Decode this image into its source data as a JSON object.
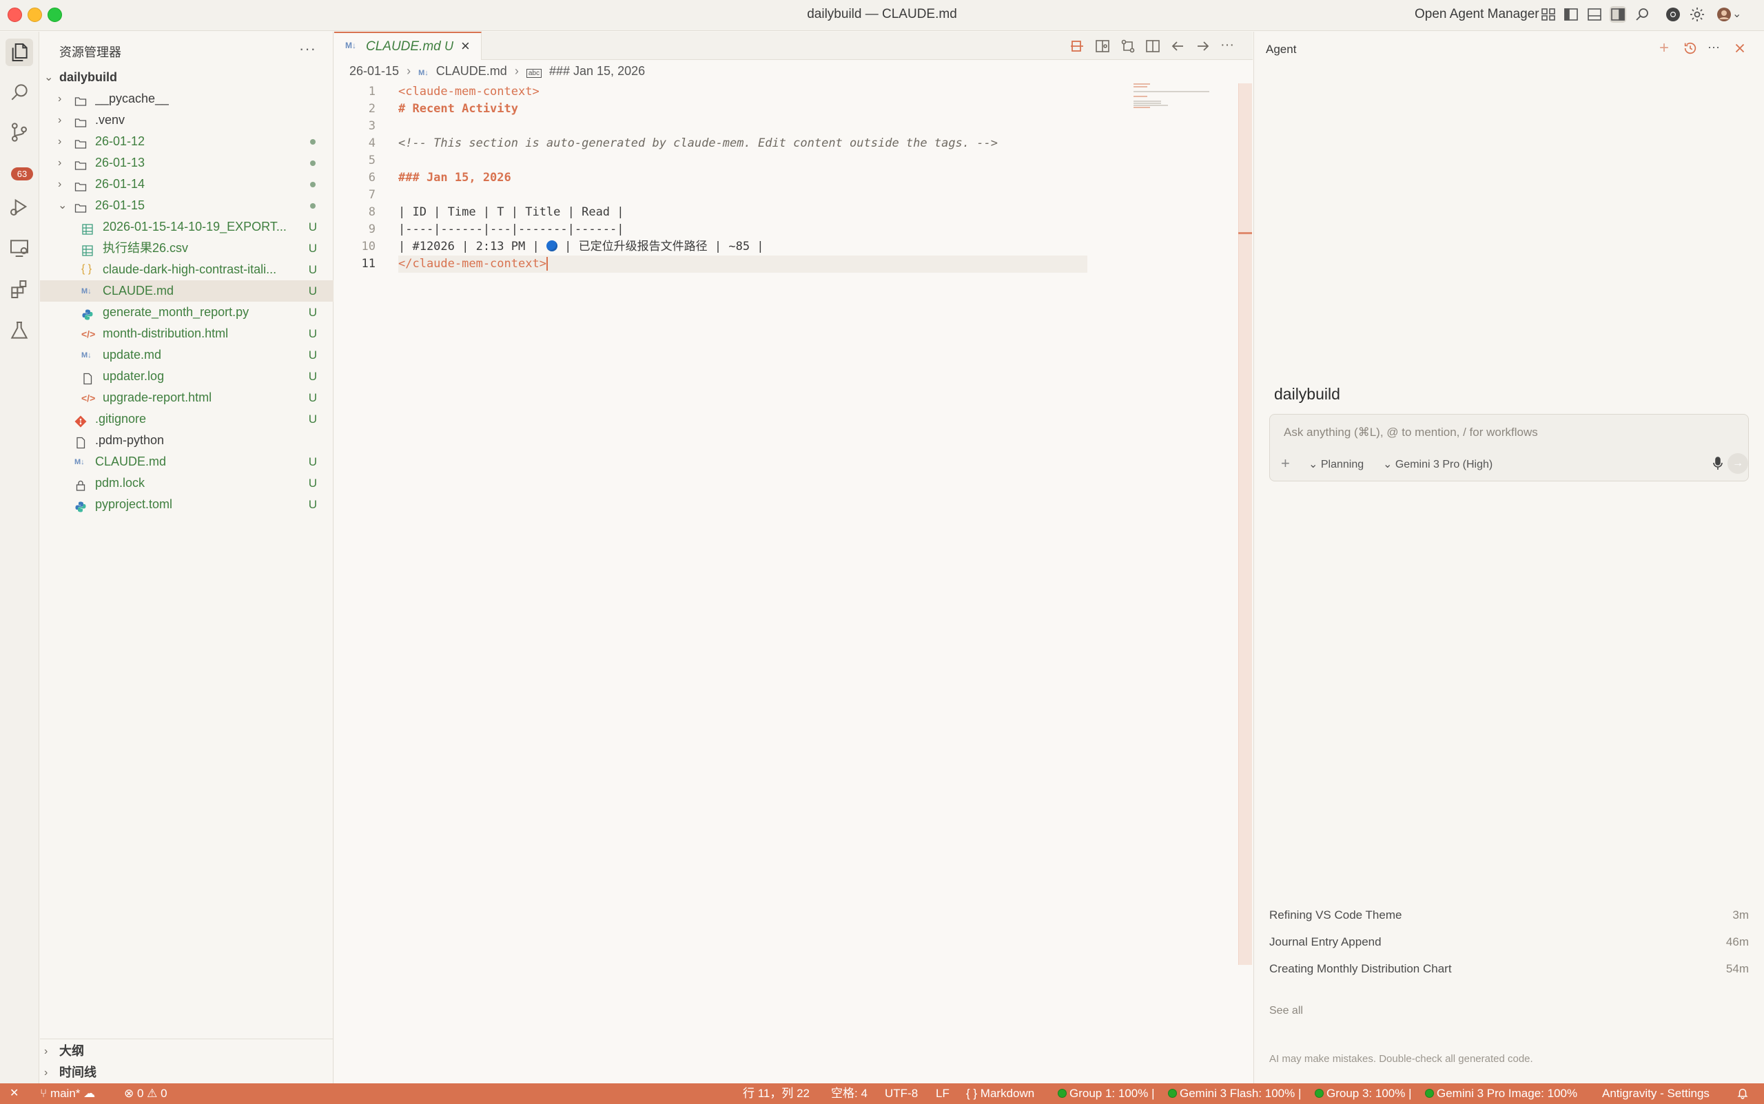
{
  "window": {
    "title": "dailybuild — CLAUDE.md",
    "open_agent_manager": "Open Agent Manager"
  },
  "activity_bar": {
    "scm_badge": "63"
  },
  "sidebar": {
    "title": "资源管理器",
    "more": "···",
    "root": "dailybuild",
    "items": [
      {
        "name": "__pycache__",
        "status": ""
      },
      {
        "name": ".venv",
        "status": ""
      },
      {
        "name": "26-01-12",
        "status": ""
      },
      {
        "name": "26-01-13",
        "status": ""
      },
      {
        "name": "26-01-14",
        "status": ""
      },
      {
        "name": "26-01-15",
        "status": ""
      },
      {
        "name": "2026-01-15-14-10-19_EXPORT...",
        "status": "U"
      },
      {
        "name": "执行结果26.csv",
        "status": "U"
      },
      {
        "name": "claude-dark-high-contrast-itali...",
        "status": "U"
      },
      {
        "name": "CLAUDE.md",
        "status": "U"
      },
      {
        "name": "generate_month_report.py",
        "status": "U"
      },
      {
        "name": "month-distribution.html",
        "status": "U"
      },
      {
        "name": "update.md",
        "status": "U"
      },
      {
        "name": "updater.log",
        "status": "U"
      },
      {
        "name": "upgrade-report.html",
        "status": "U"
      },
      {
        "name": ".gitignore",
        "status": "U"
      },
      {
        "name": ".pdm-python",
        "status": ""
      },
      {
        "name": "CLAUDE.md",
        "status": "U"
      },
      {
        "name": "pdm.lock",
        "status": "U"
      },
      {
        "name": "pyproject.toml",
        "status": "U"
      }
    ],
    "outline": "大纲",
    "timeline": "时间线"
  },
  "editor": {
    "tab": {
      "label": "CLAUDE.md",
      "status": "U",
      "icon": "M↓"
    },
    "breadcrumb": [
      "26-01-15",
      "CLAUDE.md",
      "### Jan 15, 2026"
    ],
    "lines": [
      "<claude-mem-context>",
      "# Recent Activity",
      "",
      "<!-- This section is auto-generated by claude-mem. Edit content outside the tags. -->",
      "",
      "### Jan 15, 2026",
      "",
      "| ID | Time | T | Title | Read |",
      "|----|------|---|-------|------|",
      "| #12026 | 2:13 PM | ",
      " | 已定位升级报告文件路径 | ~85 |",
      "</claude-mem-context>"
    ],
    "line_numbers": [
      "1",
      "2",
      "3",
      "4",
      "5",
      "6",
      "7",
      "8",
      "9",
      "10",
      "11"
    ]
  },
  "agent": {
    "title": "Agent",
    "workspace": "dailybuild",
    "input_placeholder": "Ask anything (⌘L), @ to mention, / for workflows",
    "mode": "Planning",
    "model": "Gemini 3 Pro (High)",
    "conversations": [
      {
        "title": "Refining VS Code Theme",
        "time": "3m"
      },
      {
        "title": "Journal Entry Append",
        "time": "46m"
      },
      {
        "title": "Creating Monthly Distribution Chart",
        "time": "54m"
      }
    ],
    "see_all": "See all",
    "disclaimer": "AI may make mistakes. Double-check all generated code."
  },
  "status_bar": {
    "branch": "main*",
    "problems": "⊗ 0 ⚠ 0",
    "position": "行 11，列 22",
    "spaces": "空格: 4",
    "encoding": "UTF-8",
    "eol": "LF",
    "language": "{ } Markdown",
    "quota1": "Group 1: 100% |",
    "quota2": "Gemini 3 Flash: 100% |",
    "quota3": "Group 3: 100% |",
    "quota4": "Gemini 3 Pro Image: 100%",
    "settings": "Antigravity - Settings"
  },
  "colors": {
    "accent": "#d8724f",
    "untracked_green": "#3f7f3f",
    "statusbar": "#d8724f"
  }
}
